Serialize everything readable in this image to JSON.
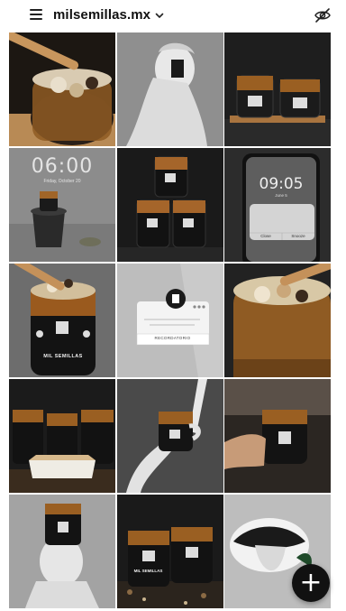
{
  "header": {
    "account_name": "milsemillas.mx",
    "menu_icon": "hamburger-menu-icon",
    "dropdown_icon": "chevron-down-icon",
    "visibility_icon": "eye-off-icon"
  },
  "grid": {
    "tiles": [
      {
        "name": "tile-jar-spoon-closeup",
        "subject": "jar with wooden spoon"
      },
      {
        "name": "tile-greek-bust-statue",
        "subject": "marble bust statue"
      },
      {
        "name": "tile-two-jars-on-board",
        "subject": "two jars on wooden board"
      },
      {
        "name": "tile-lockscreen-pedestal",
        "subject": "lock screen with jar on pedestal",
        "time": "06:00",
        "date": "Friday, October 20"
      },
      {
        "name": "tile-stacked-jars",
        "subject": "three stacked jars"
      },
      {
        "name": "tile-phone-notification",
        "subject": "phone notification",
        "time": "09:05",
        "date": "June 5",
        "button_left": "Close",
        "button_right": "Snooze"
      },
      {
        "name": "tile-jar-mil-semillas",
        "subject": "jar labeled mil semillas",
        "label": "MIL SEMILLAS"
      },
      {
        "name": "tile-reminder-card",
        "subject": "reminder card",
        "button": "RECORDATORIO"
      },
      {
        "name": "tile-jar-open-spoon",
        "subject": "open jar with spoon"
      },
      {
        "name": "tile-jars-with-cake",
        "subject": "jars with cake slice"
      },
      {
        "name": "tile-hand-holding-jar",
        "subject": "sculpted hand holding jar"
      },
      {
        "name": "tile-hand-jar-dark",
        "subject": "hand holding jar"
      },
      {
        "name": "tile-bust-jar-head",
        "subject": "bust with jar on head"
      },
      {
        "name": "tile-two-jars-scattered",
        "subject": "two jars on scattered seeds",
        "label": "MIL SEMILLAS"
      },
      {
        "name": "tile-mouth-tongue",
        "subject": "mouth with tongue"
      }
    ]
  },
  "fab": {
    "label": "+",
    "icon": "plus-icon"
  },
  "colors": {
    "dark": "#151515",
    "gray": "#9a9a9a",
    "amber": "#c77a2a",
    "wood": "#b9844c"
  }
}
